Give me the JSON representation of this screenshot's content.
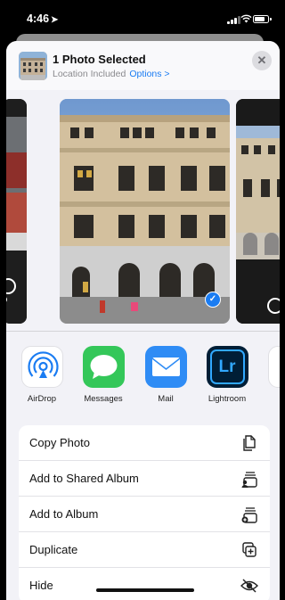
{
  "status": {
    "time": "4:46",
    "location_glyph": "➤"
  },
  "header": {
    "title": "1 Photo Selected",
    "subtitle": "Location Included",
    "options_label": "Options >",
    "close_glyph": "✕"
  },
  "preview": {
    "selected": true,
    "check_glyph": "✓"
  },
  "apps": [
    {
      "label": "AirDrop",
      "icon": "airdrop-icon",
      "color": "#ffffff"
    },
    {
      "label": "Messages",
      "icon": "messages-icon",
      "color": "#34c759"
    },
    {
      "label": "Mail",
      "icon": "mail-icon",
      "color": "#2f8cf5"
    },
    {
      "label": "Lightroom",
      "icon": "lightroom-icon",
      "color": "#001e36",
      "glyph": "Lr"
    },
    {
      "label": "",
      "icon": "partial-app-icon",
      "color": "#ffffff"
    }
  ],
  "actions": [
    {
      "label": "Copy Photo",
      "icon": "copy-icon"
    },
    {
      "label": "Add to Shared Album",
      "icon": "shared-album-icon"
    },
    {
      "label": "Add to Album",
      "icon": "add-album-icon"
    },
    {
      "label": "Duplicate",
      "icon": "duplicate-icon"
    },
    {
      "label": "Hide",
      "icon": "hide-eye-icon"
    }
  ],
  "colors": {
    "accent": "#1a7cf2",
    "sheet_bg": "#f2f2f7"
  }
}
